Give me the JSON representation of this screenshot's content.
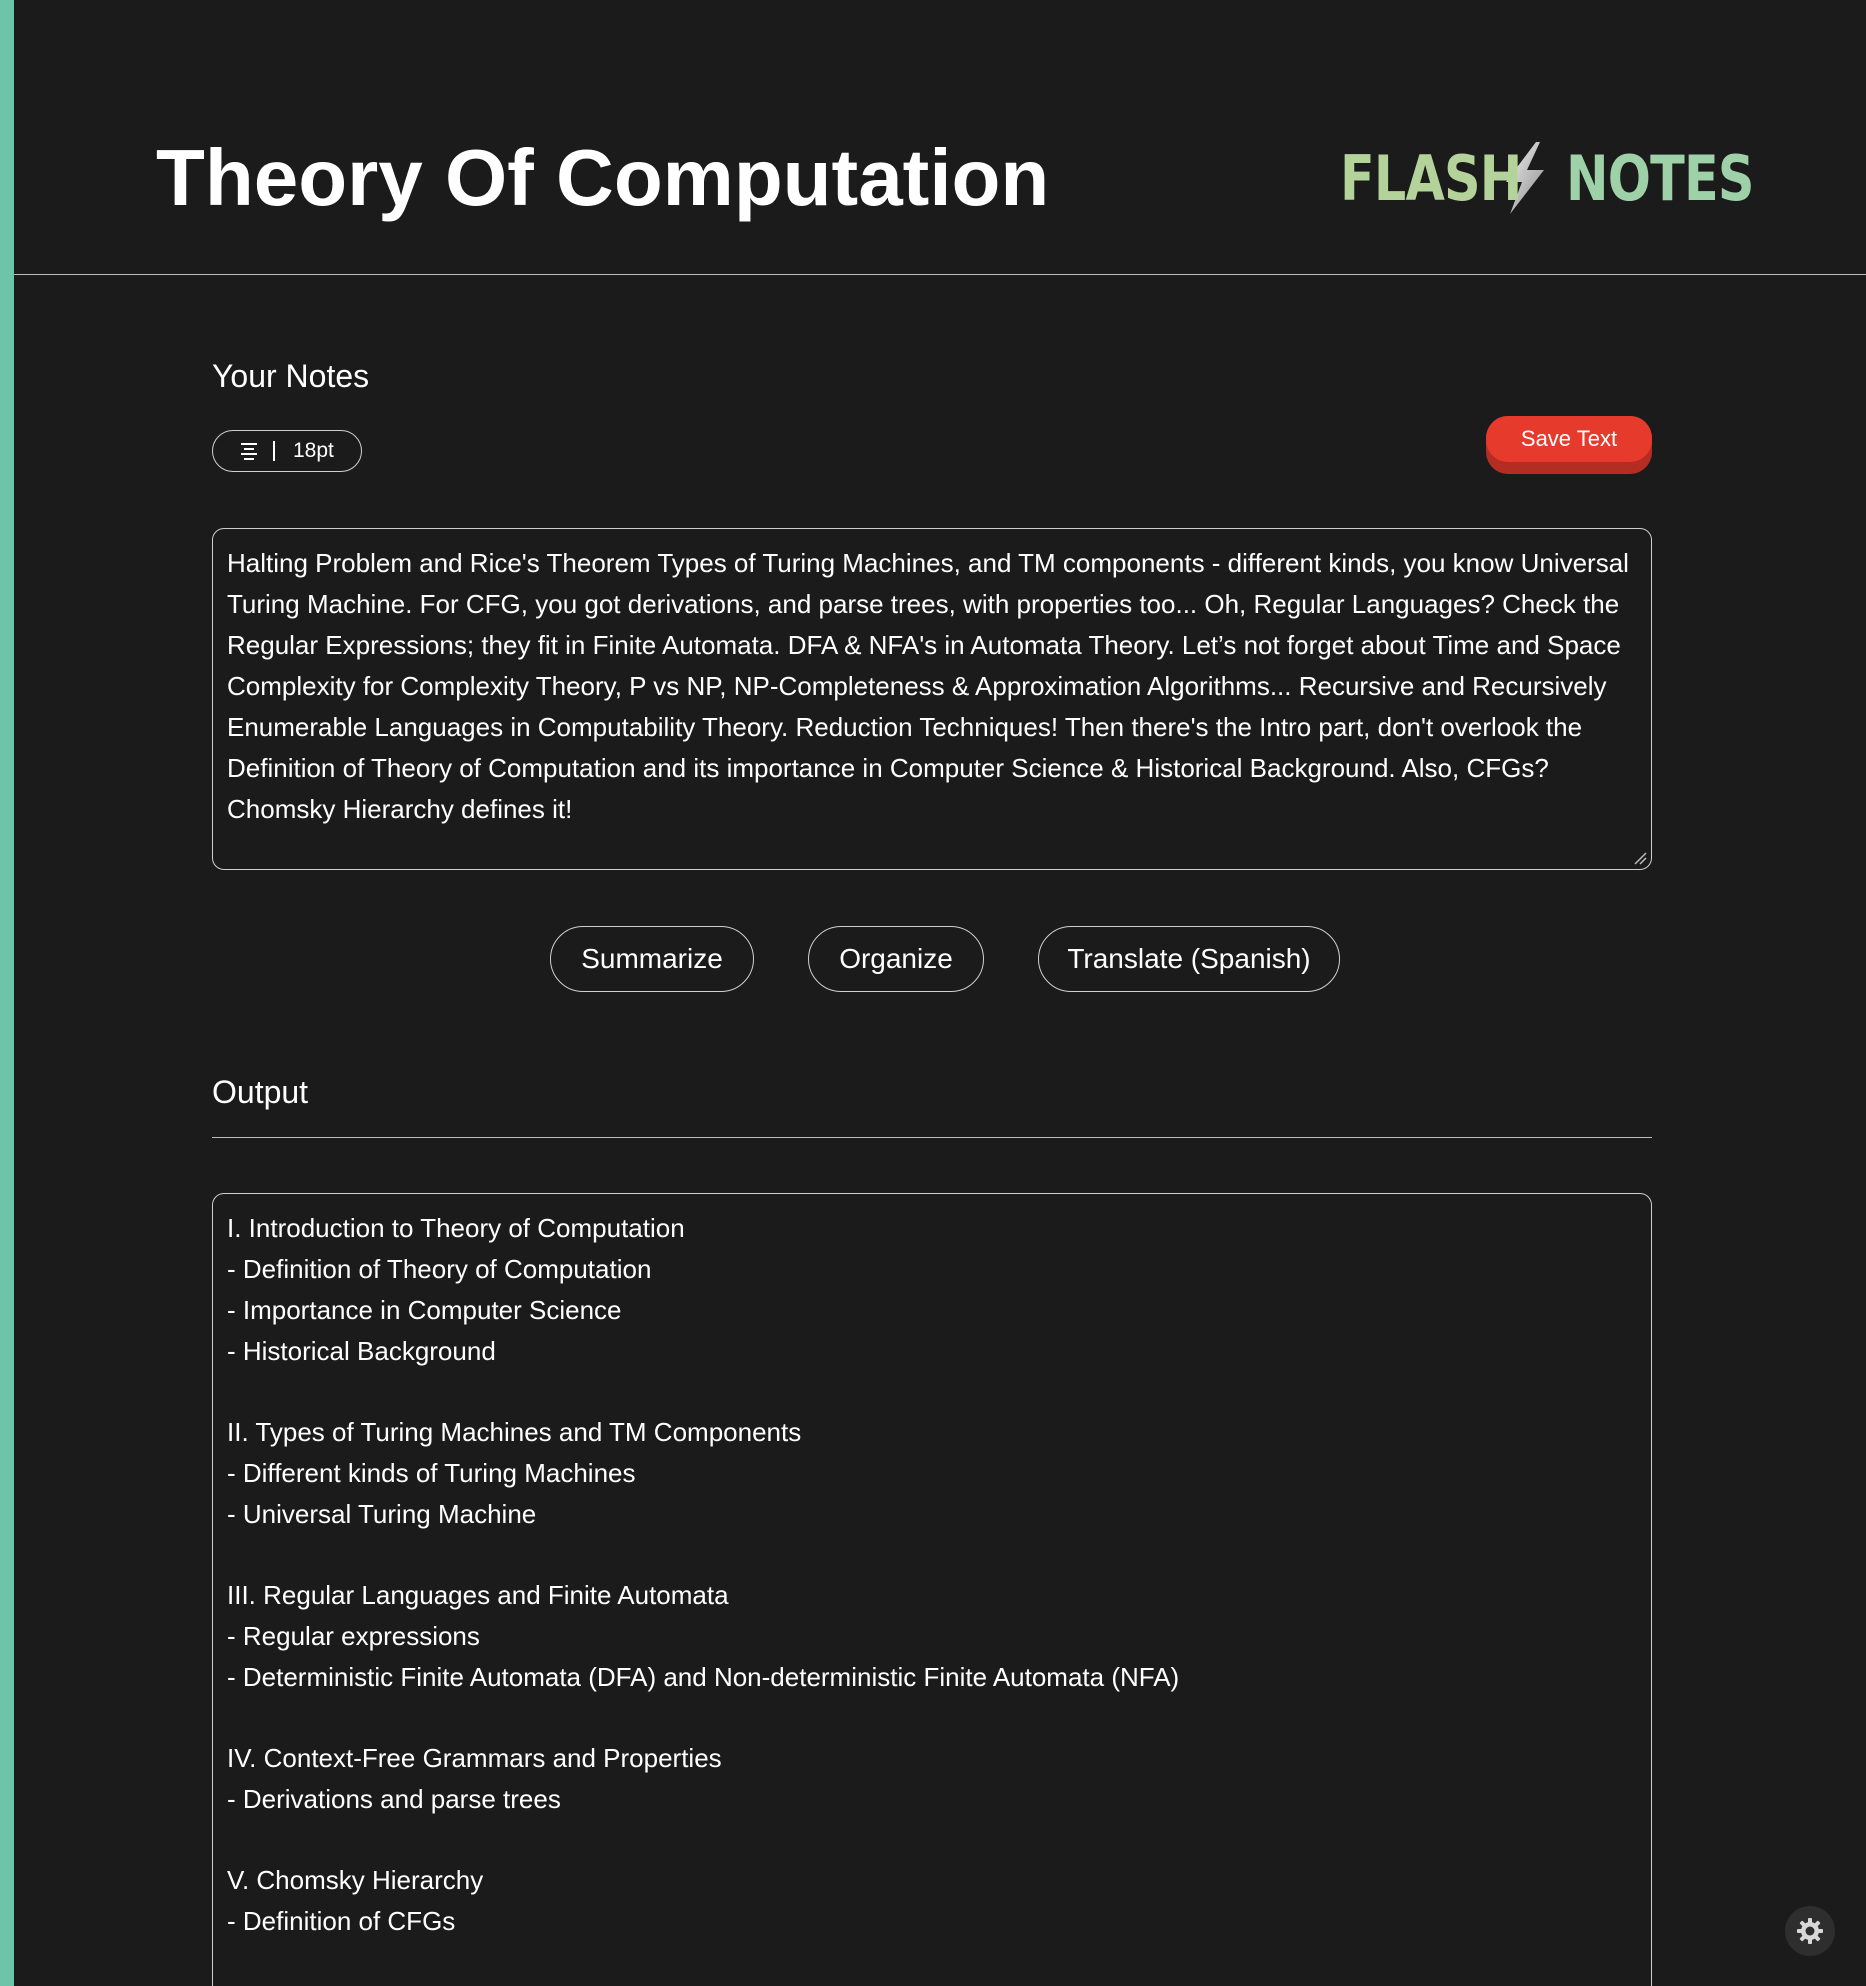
{
  "header": {
    "title": "Theory Of Computation",
    "logo": {
      "word_left": "FLASH",
      "word_right": "NOTES",
      "icon": "lightning-bolt-icon"
    }
  },
  "notes": {
    "heading": "Your Notes",
    "toolbar": {
      "align_icon": "align-center-icon",
      "font_size": "18pt"
    },
    "save_label": "Save Text",
    "text": "Halting Problem and Rice's Theorem Types of Turing Machines, and TM components - different kinds, you know Universal Turing Machine. For CFG, you got derivations, and parse trees, with properties too... Oh, Regular Languages? Check the Regular Expressions; they fit in Finite Automata. DFA & NFA's in Automata Theory. Let’s not forget about Time and Space Complexity for Complexity Theory, P vs NP, NP-Completeness & Approximation Algorithms... Recursive and Recursively Enumerable Languages in Computability Theory. Reduction Techniques! Then there's the Intro part, don't overlook the Definition of Theory of Computation and its importance in Computer Science & Historical Background. Also, CFGs? Chomsky Hierarchy defines it!"
  },
  "actions": [
    {
      "label": "Summarize"
    },
    {
      "label": "Organize"
    },
    {
      "label": "Translate (Spanish)"
    }
  ],
  "output": {
    "heading": "Output",
    "sections": [
      {
        "title": "I. Introduction to Theory of Computation",
        "items": [
          "- Definition of Theory of Computation",
          "- Importance in Computer Science",
          "- Historical Background"
        ]
      },
      {
        "title": "II. Types of Turing Machines and TM Components",
        "items": [
          "- Different kinds of Turing Machines",
          "- Universal Turing Machine"
        ]
      },
      {
        "title": "III. Regular Languages and Finite Automata",
        "items": [
          "- Regular expressions",
          "- Deterministic Finite Automata (DFA) and Non-deterministic Finite Automata (NFA)"
        ]
      },
      {
        "title": "IV. Context-Free Grammars and Properties",
        "items": [
          "- Derivations and parse trees"
        ]
      },
      {
        "title": "V. Chomsky Hierarchy",
        "items": [
          "- Definition of CFGs"
        ]
      }
    ]
  },
  "settings": {
    "icon": "gear-icon"
  },
  "colors": {
    "background": "#1b1b1b",
    "accent_bar": "#6ec4a8",
    "save_button": "#e53a2c",
    "logo_flash": "#b4d39a",
    "logo_notes": "#9ed1a8"
  }
}
